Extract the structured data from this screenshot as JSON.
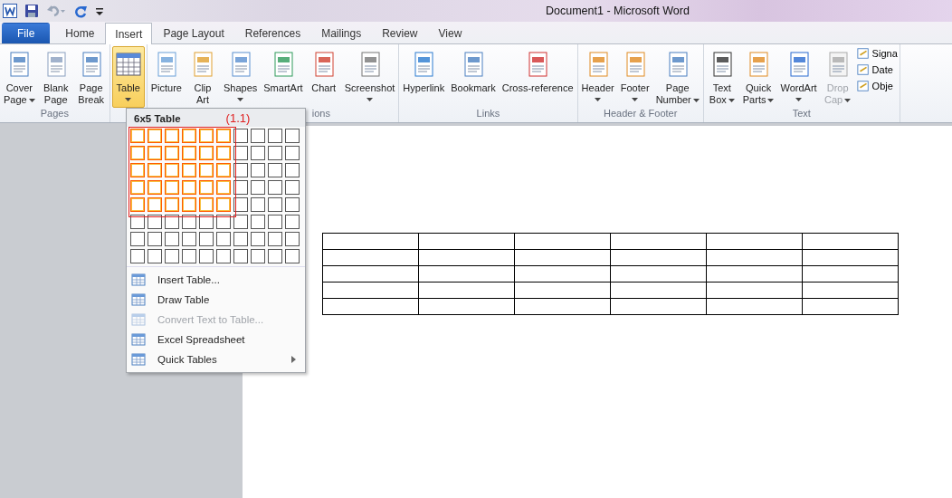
{
  "window": {
    "title": "Document1  -  Microsoft Word"
  },
  "tabs": [
    {
      "label": "File",
      "kind": "file",
      "selected": false
    },
    {
      "label": "Home",
      "kind": "tab",
      "selected": false
    },
    {
      "label": "Insert",
      "kind": "tab",
      "selected": true
    },
    {
      "label": "Page Layout",
      "kind": "tab",
      "selected": false
    },
    {
      "label": "References",
      "kind": "tab",
      "selected": false
    },
    {
      "label": "Mailings",
      "kind": "tab",
      "selected": false
    },
    {
      "label": "Review",
      "kind": "tab",
      "selected": false
    },
    {
      "label": "View",
      "kind": "tab",
      "selected": false
    }
  ],
  "groups": [
    {
      "label": "Pages",
      "buttons": [
        {
          "lines": [
            "Cover",
            "Page"
          ],
          "dropdown": true,
          "selected": false,
          "disabled": false
        },
        {
          "lines": [
            "Blank",
            "Page"
          ],
          "dropdown": false,
          "selected": false,
          "disabled": false
        },
        {
          "lines": [
            "Page",
            "Break"
          ],
          "dropdown": false,
          "selected": false,
          "disabled": false
        }
      ]
    },
    {
      "buttons": [
        {
          "lines": [
            "Table"
          ],
          "dropdown": true,
          "selected": true,
          "disabled": false
        }
      ]
    },
    {
      "label": "ions",
      "buttons": [
        {
          "lines": [
            "Picture"
          ],
          "dropdown": false,
          "selected": false,
          "disabled": false
        },
        {
          "lines": [
            "Clip",
            "Art"
          ],
          "dropdown": false,
          "selected": false,
          "disabled": false
        },
        {
          "lines": [
            "Shapes"
          ],
          "dropdown": true,
          "selected": false,
          "disabled": false
        },
        {
          "lines": [
            "SmartArt"
          ],
          "dropdown": false,
          "selected": false,
          "disabled": false
        },
        {
          "lines": [
            "Chart"
          ],
          "dropdown": false,
          "selected": false,
          "disabled": false
        },
        {
          "lines": [
            "Screenshot"
          ],
          "dropdown": true,
          "selected": false,
          "disabled": false
        }
      ]
    },
    {
      "label": "Links",
      "buttons": [
        {
          "lines": [
            "Hyperlink"
          ],
          "dropdown": false,
          "selected": false,
          "disabled": false
        },
        {
          "lines": [
            "Bookmark"
          ],
          "dropdown": false,
          "selected": false,
          "disabled": false
        },
        {
          "lines": [
            "Cross-reference"
          ],
          "dropdown": false,
          "selected": false,
          "disabled": false
        }
      ]
    },
    {
      "label": "Header & Footer",
      "buttons": [
        {
          "lines": [
            "Header"
          ],
          "dropdown": true,
          "selected": false,
          "disabled": false
        },
        {
          "lines": [
            "Footer"
          ],
          "dropdown": true,
          "selected": false,
          "disabled": false
        },
        {
          "lines": [
            "Page",
            "Number"
          ],
          "dropdown": true,
          "selected": false,
          "disabled": false
        }
      ]
    },
    {
      "label": "Text",
      "buttons": [
        {
          "lines": [
            "Text",
            "Box"
          ],
          "dropdown": true,
          "selected": false,
          "disabled": false
        },
        {
          "lines": [
            "Quick",
            "Parts"
          ],
          "dropdown": true,
          "selected": false,
          "disabled": false
        },
        {
          "lines": [
            "WordArt"
          ],
          "dropdown": true,
          "selected": false,
          "disabled": false
        },
        {
          "lines": [
            "Drop",
            "Cap"
          ],
          "dropdown": true,
          "selected": false,
          "disabled": true
        }
      ],
      "small": [
        "Signa",
        "Date",
        "Obje"
      ]
    }
  ],
  "table_menu": {
    "header": "6x5 Table",
    "annotation": "(1.1)",
    "grid": [
      {
        "cells": [
          {
            "selected": true
          },
          {
            "selected": true
          },
          {
            "selected": true
          },
          {
            "selected": true
          },
          {
            "selected": true
          },
          {
            "selected": true
          },
          {
            "selected": false
          },
          {
            "selected": false
          },
          {
            "selected": false
          },
          {
            "selected": false
          }
        ]
      },
      {
        "cells": [
          {
            "selected": true
          },
          {
            "selected": true
          },
          {
            "selected": true
          },
          {
            "selected": true
          },
          {
            "selected": true
          },
          {
            "selected": true
          },
          {
            "selected": false
          },
          {
            "selected": false
          },
          {
            "selected": false
          },
          {
            "selected": false
          }
        ]
      },
      {
        "cells": [
          {
            "selected": true
          },
          {
            "selected": true
          },
          {
            "selected": true
          },
          {
            "selected": true
          },
          {
            "selected": true
          },
          {
            "selected": true
          },
          {
            "selected": false
          },
          {
            "selected": false
          },
          {
            "selected": false
          },
          {
            "selected": false
          }
        ]
      },
      {
        "cells": [
          {
            "selected": true
          },
          {
            "selected": true
          },
          {
            "selected": true
          },
          {
            "selected": true
          },
          {
            "selected": true
          },
          {
            "selected": true
          },
          {
            "selected": false
          },
          {
            "selected": false
          },
          {
            "selected": false
          },
          {
            "selected": false
          }
        ]
      },
      {
        "cells": [
          {
            "selected": true
          },
          {
            "selected": true
          },
          {
            "selected": true
          },
          {
            "selected": true
          },
          {
            "selected": true
          },
          {
            "selected": true
          },
          {
            "selected": false
          },
          {
            "selected": false
          },
          {
            "selected": false
          },
          {
            "selected": false
          }
        ]
      },
      {
        "cells": [
          {
            "selected": false
          },
          {
            "selected": false
          },
          {
            "selected": false
          },
          {
            "selected": false
          },
          {
            "selected": false
          },
          {
            "selected": false
          },
          {
            "selected": false
          },
          {
            "selected": false
          },
          {
            "selected": false
          },
          {
            "selected": false
          }
        ]
      },
      {
        "cells": [
          {
            "selected": false
          },
          {
            "selected": false
          },
          {
            "selected": false
          },
          {
            "selected": false
          },
          {
            "selected": false
          },
          {
            "selected": false
          },
          {
            "selected": false
          },
          {
            "selected": false
          },
          {
            "selected": false
          },
          {
            "selected": false
          }
        ]
      },
      {
        "cells": [
          {
            "selected": false
          },
          {
            "selected": false
          },
          {
            "selected": false
          },
          {
            "selected": false
          },
          {
            "selected": false
          },
          {
            "selected": false
          },
          {
            "selected": false
          },
          {
            "selected": false
          },
          {
            "selected": false
          },
          {
            "selected": false
          }
        ]
      }
    ],
    "items": [
      {
        "label": "Insert Table...",
        "disabled": false,
        "submenu": false
      },
      {
        "label": "Draw Table",
        "disabled": false,
        "submenu": false
      },
      {
        "label": "Convert Text to Table...",
        "disabled": true,
        "submenu": false
      },
      {
        "label": "Excel Spreadsheet",
        "disabled": false,
        "submenu": false
      },
      {
        "label": "Quick Tables",
        "disabled": false,
        "submenu": true
      }
    ]
  }
}
